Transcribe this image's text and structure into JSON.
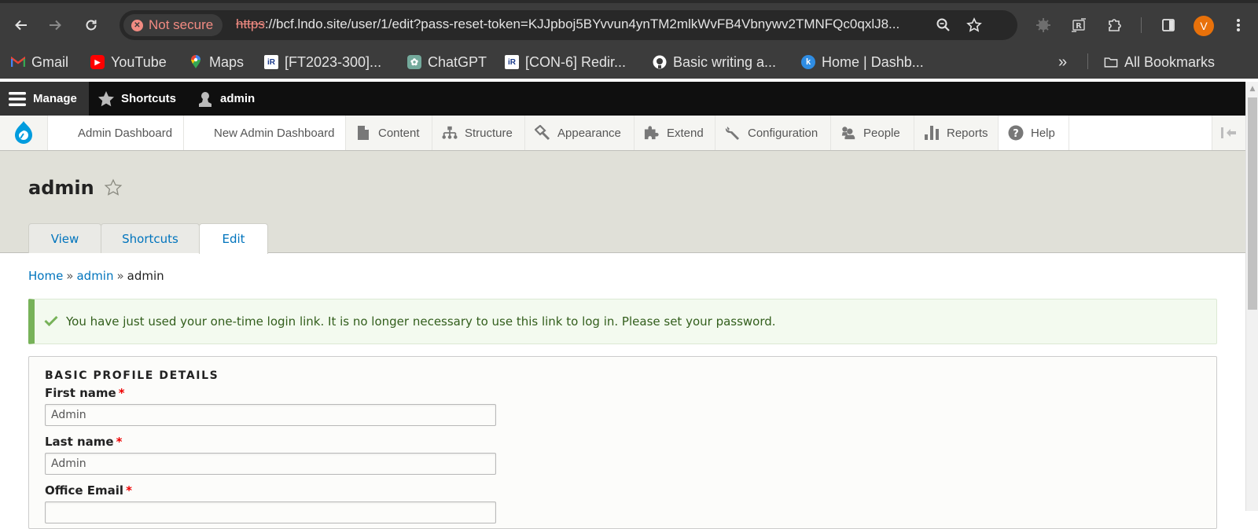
{
  "browser": {
    "nav": {
      "back": "back-arrow",
      "forward": "forward-arrow",
      "reload": "reload"
    },
    "security_label": "Not secure",
    "url_scheme": "https",
    "url_rest": "://bcf.lndo.site/user/1/edit?pass-reset-token=KJJpboj5BYvvun4ynTM2mlkWvFB4Vbnywv2TMNFQc0qxlJ8...",
    "avatar_letter": "V",
    "bookmarks": [
      {
        "label": "Gmail",
        "icon": "M",
        "color": "#ea4335"
      },
      {
        "label": "YouTube",
        "icon": "▶",
        "color": "#ff0000"
      },
      {
        "label": "Maps",
        "icon": "⬤",
        "color": "#34a853"
      },
      {
        "label": "[FT2023-300]...",
        "icon": "iR",
        "color": "#1a3a8a"
      },
      {
        "label": "ChatGPT",
        "icon": "✿",
        "color": "#74aa9c"
      },
      {
        "label": "[CON-6] Redir...",
        "icon": "iR",
        "color": "#1a3a8a"
      },
      {
        "label": "Basic writing a...",
        "icon": "◉",
        "color": "#ffffff"
      },
      {
        "label": "Home | Dashb...",
        "icon": "k",
        "color": "#2f8de4"
      }
    ],
    "more_bookmarks": "»",
    "all_bookmarks_label": "All Bookmarks"
  },
  "toolbar": {
    "manage_label": "Manage",
    "shortcuts_label": "Shortcuts",
    "user_label": "admin"
  },
  "tray": {
    "items": [
      {
        "label": "Admin Dashboard"
      },
      {
        "label": "New Admin Dashboard"
      },
      {
        "label": "Content"
      },
      {
        "label": "Structure"
      },
      {
        "label": "Appearance"
      },
      {
        "label": "Extend"
      },
      {
        "label": "Configuration"
      },
      {
        "label": "People"
      },
      {
        "label": "Reports"
      },
      {
        "label": "Help"
      }
    ]
  },
  "page": {
    "title": "admin",
    "tabs": [
      {
        "label": "View"
      },
      {
        "label": "Shortcuts"
      },
      {
        "label": "Edit",
        "active": true
      }
    ],
    "breadcrumb": [
      {
        "label": "Home",
        "link": true
      },
      {
        "label": "admin",
        "link": true
      },
      {
        "label": "admin",
        "link": false
      }
    ],
    "breadcrumb_sep": "»",
    "status_message": "You have just used your one-time login link. It is no longer necessary to use this link to log in. Please set your password."
  },
  "form": {
    "legend": "BASIC PROFILE DETAILS",
    "required_marker": "*",
    "fields": [
      {
        "label": "First name",
        "value": "Admin",
        "required": true
      },
      {
        "label": "Last name",
        "value": "Admin",
        "required": true
      },
      {
        "label": "Office Email",
        "value": "",
        "required": true
      }
    ]
  },
  "colors": {
    "link": "#0074bd",
    "success_border": "#77b259",
    "success_text": "#325e1c",
    "required": "#ee0000",
    "drupal_blue": "#009cde"
  }
}
